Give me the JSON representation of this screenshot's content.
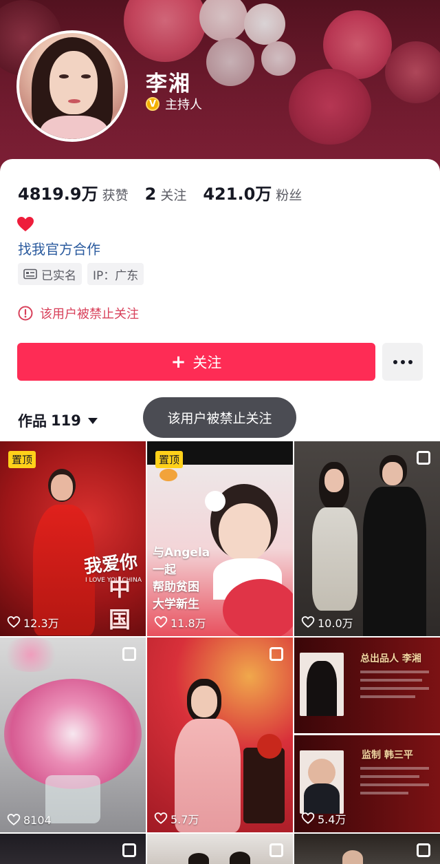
{
  "profile": {
    "name": "李湘",
    "verified_label": "主持人",
    "verified_badge": "V"
  },
  "stats": [
    {
      "value": "4819.9万",
      "label": "获赞"
    },
    {
      "value": "2",
      "label": "关注"
    },
    {
      "value": "421.0万",
      "label": "粉丝"
    }
  ],
  "official_link": "找我官方合作",
  "tags": {
    "realname": "已实名",
    "ip": "IP：广东"
  },
  "banned_notice": "该用户被禁止关注",
  "follow_button": "关注",
  "works_tab": {
    "label": "作品",
    "count": "119"
  },
  "toast": "该用户被禁止关注",
  "videos": [
    {
      "likes": "12.3万",
      "pinned": "置顶",
      "caption": "我爱你",
      "caption2": "中国",
      "sub": "I LOVE YOU CHINA"
    },
    {
      "likes": "11.8万",
      "pinned": "置顶",
      "lines": [
        "与Angela",
        "一起",
        "帮助贫困",
        "大学新生"
      ]
    },
    {
      "likes": "10.0万"
    },
    {
      "likes": "8104"
    },
    {
      "likes": "5.7万"
    },
    {
      "likes": "5.4万",
      "title_top": "总出品人 李湘",
      "title_bottom": "监制 韩三平"
    }
  ],
  "colors": {
    "accent": "#fe2c55",
    "link": "#2a5a9e",
    "warning": "#d8405a",
    "pin": "#ffd11a"
  }
}
